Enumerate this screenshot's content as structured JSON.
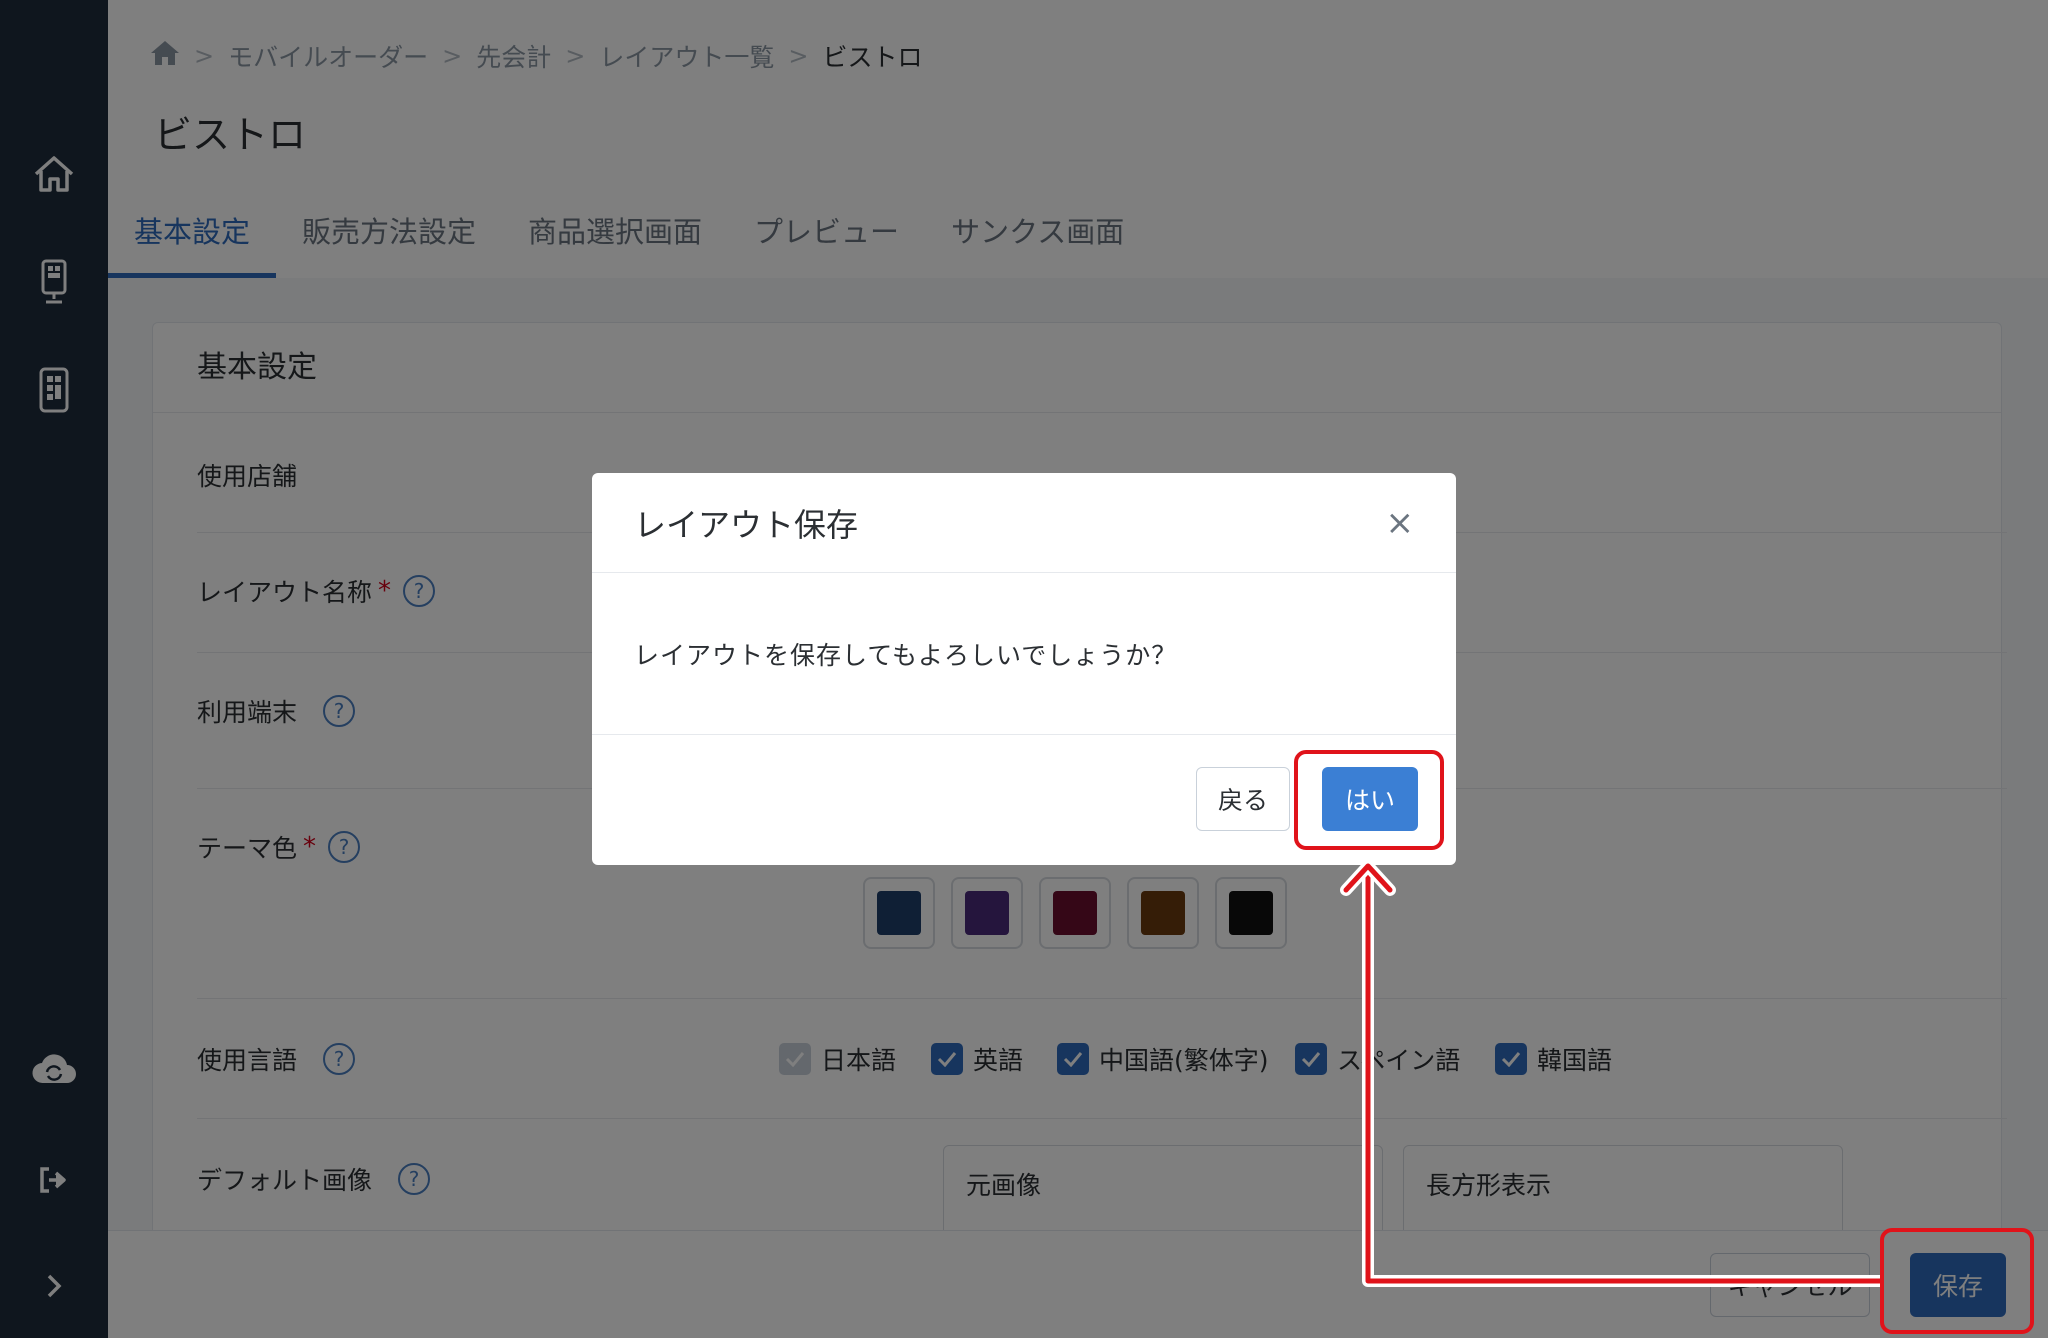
{
  "breadcrumb": {
    "items": [
      "モバイルオーダー",
      "先会計",
      "レイアウト一覧"
    ],
    "current": "ビストロ"
  },
  "page_title": "ビストロ",
  "tabs": [
    {
      "label": "基本設定",
      "active": true
    },
    {
      "label": "販売方法設定",
      "active": false
    },
    {
      "label": "商品選択画面",
      "active": false
    },
    {
      "label": "プレビュー",
      "active": false
    },
    {
      "label": "サンクス画面",
      "active": false
    }
  ],
  "card": {
    "title": "基本設定",
    "fields": {
      "store": "使用店舗",
      "layout_name": "レイアウト名称",
      "device": "利用端末",
      "theme": "テーマ色",
      "language": "使用言語",
      "default_image": "デフォルト画像"
    },
    "help_mark": "?",
    "required_mark": "*"
  },
  "theme_colors": {
    "row1": [
      "#8b1a1a",
      "#c94a7a",
      "#c96a16",
      "#c9a400",
      "#2e8b2e"
    ],
    "row2": [
      "#1e3f6b",
      "#4a2a7a",
      "#6b0f2e",
      "#6b3a0f",
      "#111111"
    ]
  },
  "languages": [
    {
      "label": "日本語",
      "checked": true,
      "disabled": true
    },
    {
      "label": "英語",
      "checked": true,
      "disabled": false
    },
    {
      "label": "中国語(繁体字)",
      "checked": true,
      "disabled": false
    },
    {
      "label": "スペイン語",
      "checked": true,
      "disabled": false
    },
    {
      "label": "韓国語",
      "checked": true,
      "disabled": false
    }
  ],
  "image_boxes": {
    "original": "元画像",
    "rect": "長方形表示"
  },
  "footer": {
    "cancel_label": "キャンセル",
    "save_label": "保存"
  },
  "modal": {
    "title": "レイアウト保存",
    "close": "×",
    "message": "レイアウトを保存してもよろしいでしょうか？",
    "back_label": "戻る",
    "yes_label": "はい"
  },
  "colors": {
    "sidebar": "#1f2c3c",
    "accent": "#2e6bbd",
    "annotation": "#e0131a"
  }
}
